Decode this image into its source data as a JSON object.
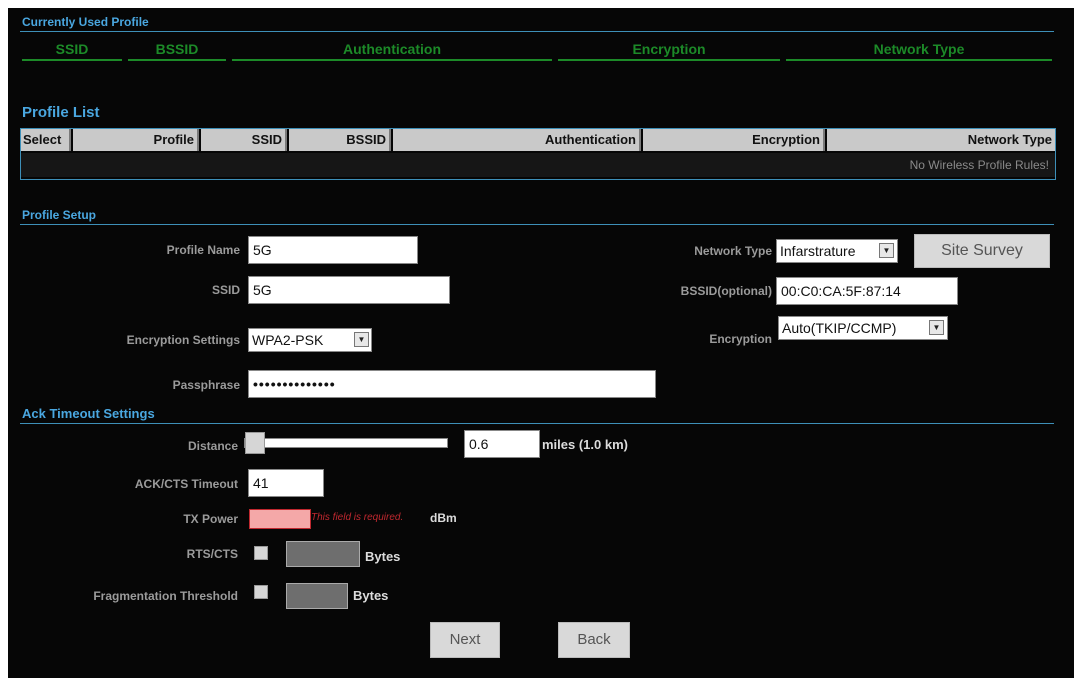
{
  "current_profile": {
    "title": "Currently Used Profile",
    "columns": [
      "SSID",
      "BSSID",
      "Authentication",
      "Encryption",
      "Network Type"
    ]
  },
  "profile_list": {
    "title": "Profile List",
    "columns": [
      "Select",
      "Profile",
      "SSID",
      "BSSID",
      "Authentication",
      "Encryption",
      "Network Type"
    ],
    "empty_message": "No Wireless Profile Rules!"
  },
  "profile_setup": {
    "title": "Profile Setup",
    "profile_name_label": "Profile Name",
    "profile_name_value": "5G",
    "ssid_label": "SSID",
    "ssid_value": "5G",
    "encryption_settings_label": "Encryption Settings",
    "encryption_settings_value": "WPA2-PSK",
    "passphrase_label": "Passphrase",
    "passphrase_value": "••••••••••••••",
    "network_type_label": "Network Type",
    "network_type_value": "Infarstrature",
    "site_survey_label": "Site Survey",
    "bssid_label": "BSSID(optional)",
    "bssid_value": "00:C0:CA:5F:87:14",
    "encryption_label": "Encryption",
    "encryption_value": "Auto(TKIP/CCMP)"
  },
  "ack_timeout": {
    "title": "Ack Timeout Settings",
    "distance_label": "Distance",
    "distance_slider_fraction": 0.0,
    "distance_value": "0.6",
    "distance_unit": "miles (1.0 km)",
    "ack_cts_label": "ACK/CTS Timeout",
    "ack_cts_value": "41",
    "tx_power_label": "TX Power",
    "tx_power_error": "This field is required.",
    "tx_power_unit": "dBm",
    "rts_cts_label": "RTS/CTS",
    "rts_cts_unit": "Bytes",
    "frag_label": "Fragmentation Threshold",
    "frag_unit": "Bytes"
  },
  "buttons": {
    "next": "Next",
    "back": "Back"
  },
  "colors": {
    "panel_bg": "#060606",
    "section_title": "#4aa7e0",
    "green_header": "#1c8a28",
    "error_text": "#c0282f"
  }
}
